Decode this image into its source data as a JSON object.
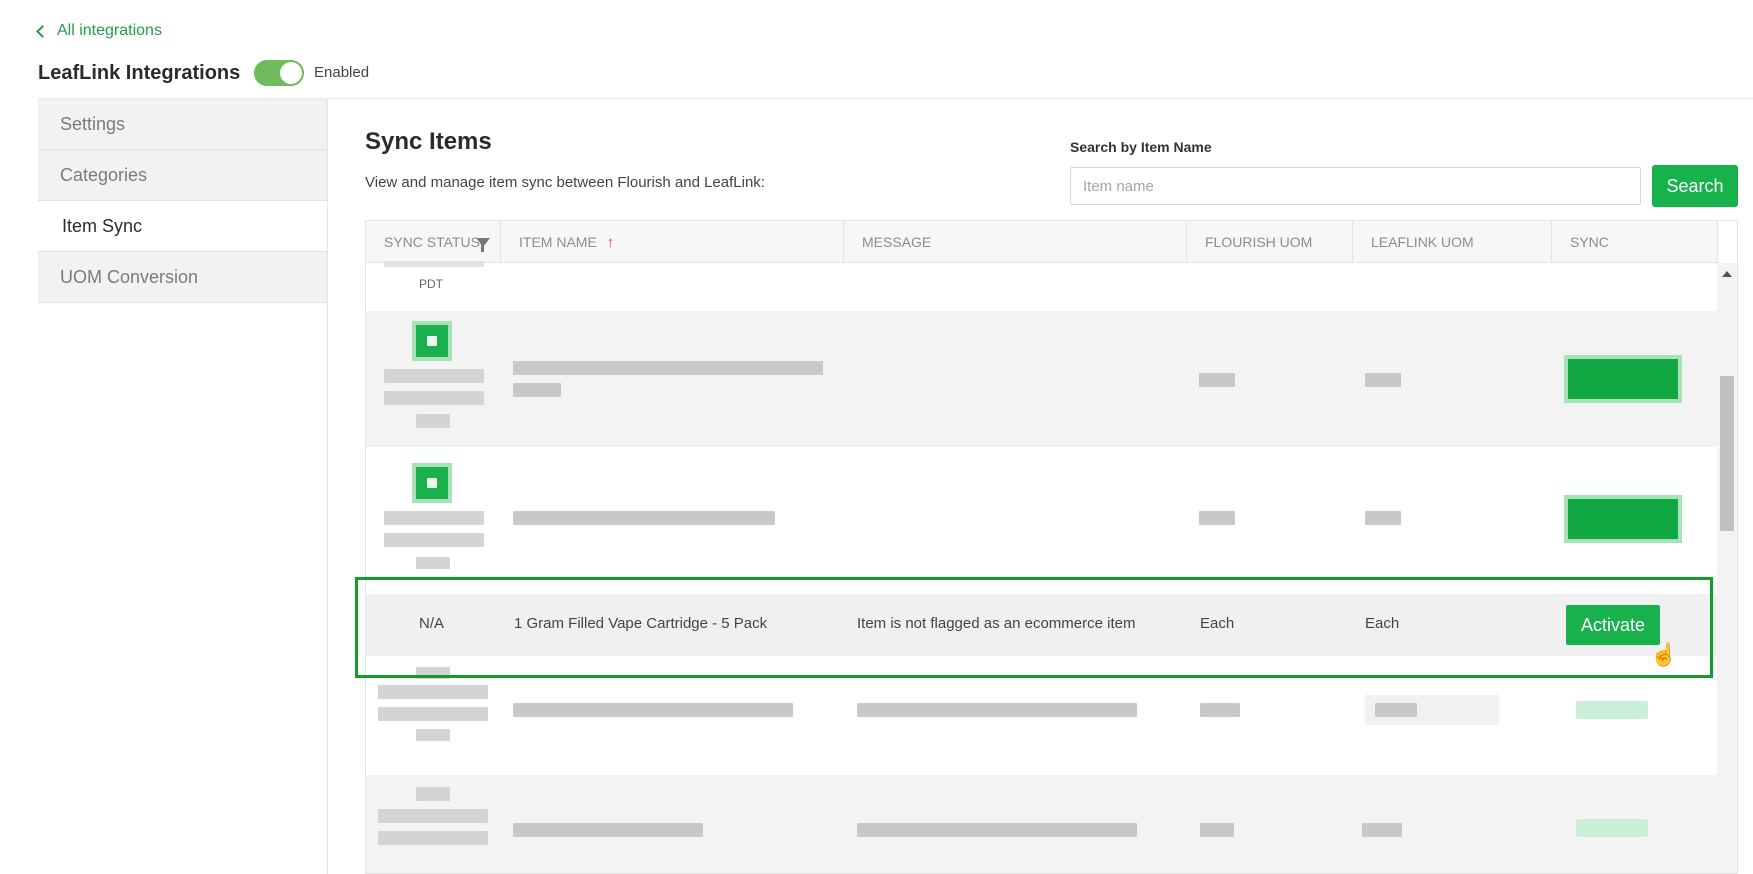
{
  "nav": {
    "back_label": "All integrations"
  },
  "header": {
    "title": "LeafLink Integrations",
    "toggle_label": "Enabled",
    "enabled": true
  },
  "sidebar": {
    "items": [
      {
        "label": "Settings",
        "active": false
      },
      {
        "label": "Categories",
        "active": false
      },
      {
        "label": "Item Sync",
        "active": true
      },
      {
        "label": "UOM Conversion",
        "active": false
      }
    ]
  },
  "main": {
    "title": "Sync Items",
    "subtitle": "View and manage item sync between Flourish and LeafLink:"
  },
  "search": {
    "label": "Search by Item Name",
    "placeholder": "Item name",
    "value": "",
    "button_label": "Search"
  },
  "table": {
    "columns": [
      "SYNC STATUS",
      "ITEM NAME",
      "MESSAGE",
      "FLOURISH UOM",
      "LEAFLINK UOM",
      "SYNC"
    ],
    "sorted_column": "ITEM NAME",
    "sort_direction": "ascending",
    "partial_row": {
      "status_timezone": "PDT"
    },
    "highlighted_row": {
      "sync_status": "N/A",
      "item_name": "1 Gram Filled Vape Cartridge - 5 Pack",
      "message": "Item is not flagged as an ecommerce item",
      "flourish_uom": "Each",
      "leaflink_uom": "Each",
      "action_label": "Activate"
    }
  },
  "colors": {
    "accent": "#17b24c",
    "link": "#1e9e4a",
    "highlight_border": "#109d2a",
    "sort_arrow": "#e04a3c"
  }
}
